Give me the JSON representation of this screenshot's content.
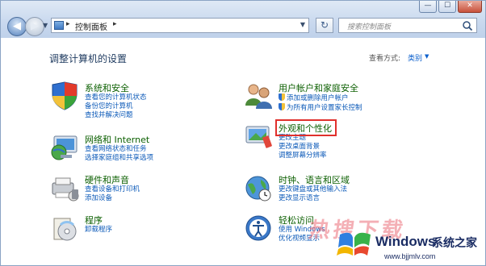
{
  "window": {
    "controls": {
      "minimize": "—",
      "maximize": "☐",
      "close": "✕"
    }
  },
  "nav": {
    "back_glyph": "◀",
    "forward_glyph": "▶",
    "address": {
      "separator": "▸",
      "path": "控制面板",
      "separator_after": "▸"
    },
    "refresh_glyph": "↻",
    "search_placeholder": "搜索控制面板"
  },
  "page": {
    "title": "调整计算机的设置",
    "view_by_label": "查看方式:",
    "view_by_value": "类别",
    "view_by_arrow": "▼"
  },
  "categories_left": [
    {
      "title": "系统和安全",
      "icon": "system-security-icon",
      "links": [
        "查看您的计算机状态",
        "备份您的计算机",
        "查找并解决问题"
      ]
    },
    {
      "title": "网络和 Internet",
      "icon": "network-internet-icon",
      "links": [
        "查看网络状态和任务",
        "选择家庭组和共享选项"
      ]
    },
    {
      "title": "硬件和声音",
      "icon": "hardware-sound-icon",
      "links": [
        "查看设备和打印机",
        "添加设备"
      ]
    },
    {
      "title": "程序",
      "icon": "programs-icon",
      "links": [
        "卸载程序"
      ]
    }
  ],
  "categories_right": [
    {
      "title": "用户帐户和家庭安全",
      "icon": "user-accounts-icon",
      "links": [
        "添加或删除用户帐户",
        "为所有用户设置家长控制"
      ]
    },
    {
      "title": "外观和个性化",
      "icon": "appearance-icon",
      "links": [
        "更改主题",
        "更改桌面背景",
        "调整屏幕分辨率"
      ]
    },
    {
      "title": "时钟、语言和区域",
      "icon": "clock-language-icon",
      "links": [
        "更改键盘或其他输入法",
        "更改显示语言"
      ]
    },
    {
      "title": "轻松访问",
      "icon": "ease-of-access-icon",
      "links": [
        "使用 Windows",
        "优化视频显示"
      ]
    }
  ],
  "watermark": {
    "chinese_text": "热搜下载",
    "brand": "Windows",
    "brand_suffix": "系统之家",
    "url": "www.bjjmlv.com"
  },
  "colors": {
    "link": "#0b59b8",
    "category_title": "#0b5f00",
    "highlight": "#e0302c"
  }
}
